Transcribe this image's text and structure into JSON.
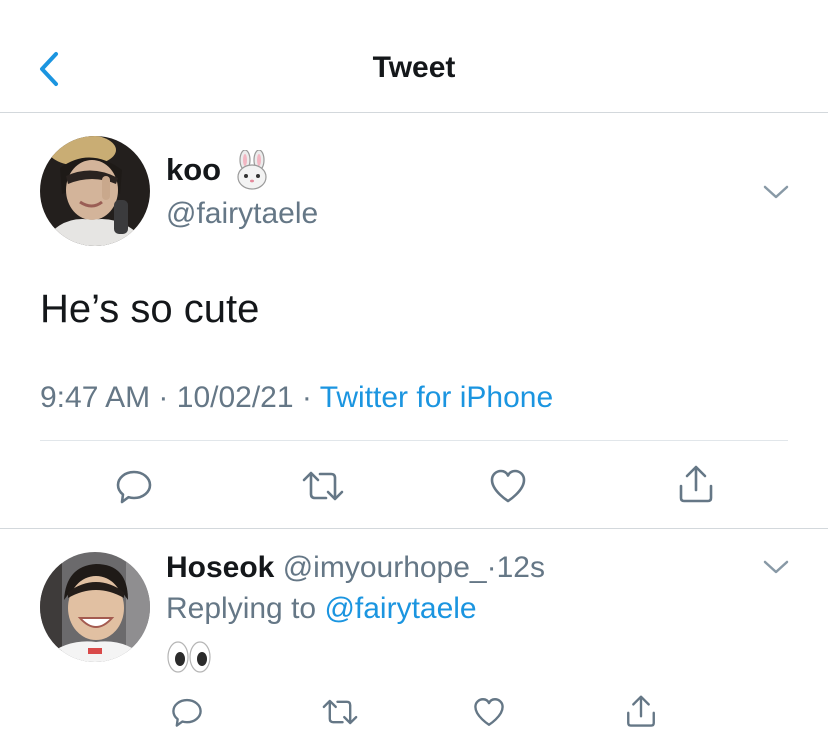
{
  "header": {
    "title": "Tweet",
    "back_icon": "chevron-left-icon"
  },
  "tweet": {
    "author_name": "koo",
    "author_emoji": "rabbit-face-icon",
    "author_handle": "@fairytaele",
    "text": "He’s so cute",
    "time": "9:47 AM",
    "date": "10/02/21",
    "separator": "·",
    "source": "Twitter for iPhone",
    "actions": [
      "reply-icon",
      "retweet-icon",
      "like-icon",
      "share-icon"
    ]
  },
  "reply": {
    "author_name": "Hoseok",
    "author_handle": "@imyourhope_",
    "time": "12s",
    "separator": "·",
    "replying_prefix": "Replying to",
    "replying_to": "@fairytaele",
    "content_emoji": "eyes-icon",
    "actions": [
      "reply-icon",
      "retweet-icon",
      "like-icon",
      "share-icon"
    ]
  },
  "colors": {
    "accent": "#1b95e0",
    "secondary_text": "#657786",
    "primary_text": "#14171a",
    "divider": "#d3d8dc"
  }
}
